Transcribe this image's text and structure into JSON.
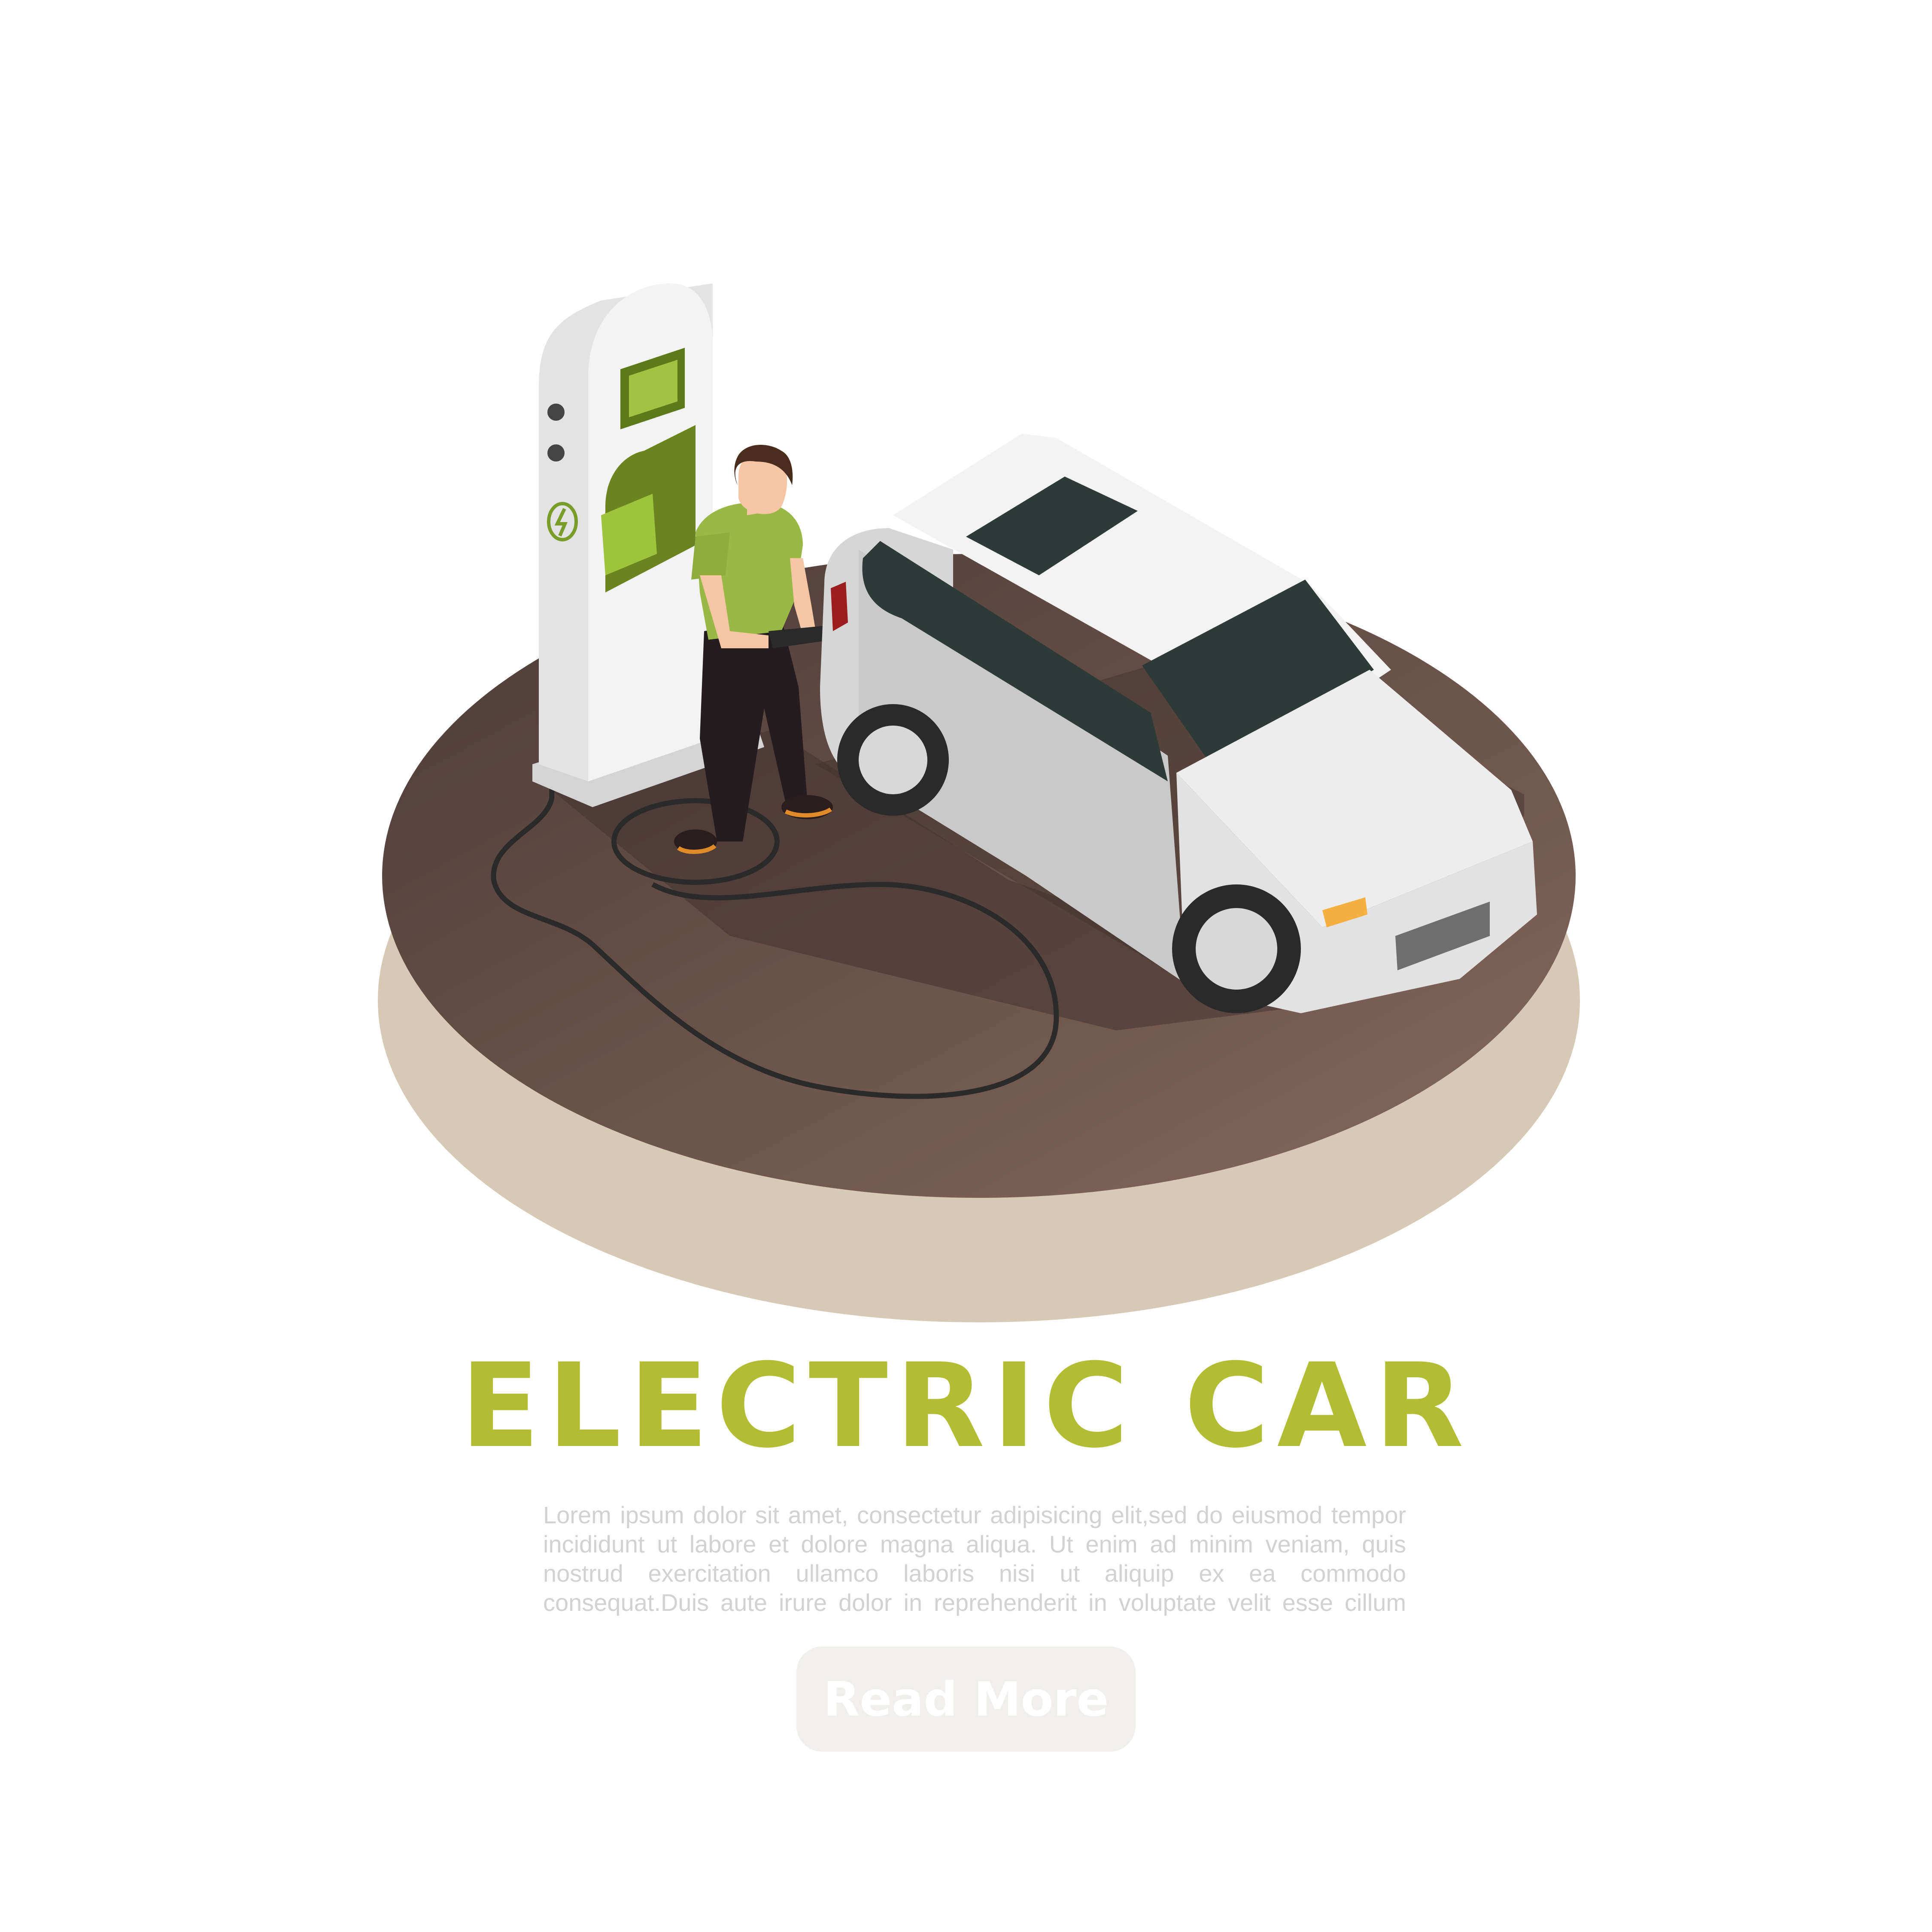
{
  "banner": {
    "title": "ELECTRIC CAR",
    "body": "Lorem ipsum dolor sit amet, consectetur adipisicing elit,sed do eiusmod tempor incididunt ut labore et dolore magna aliqua. Ut enim ad minim veniam, quis nostrud exercitation ullamco laboris nisi ut aliquip ex ea commodo consequat.Duis aute irure dolor in reprehenderit in voluptate velit esse cillum",
    "button_label": "Read More"
  },
  "colors": {
    "title": "#b2bd33",
    "body_text": "#d2d2d2",
    "button_bg": "#f0efec",
    "button_text": "#ffffff",
    "platform_top": "#6f5a52",
    "platform_side": "#d6c9b6",
    "charger_accent": "#8cb53a",
    "car_body": "#ececec",
    "shirt": "#99b846",
    "cable": "#2a2a2a"
  },
  "icons": {
    "charger_badge": "lightning-icon"
  }
}
